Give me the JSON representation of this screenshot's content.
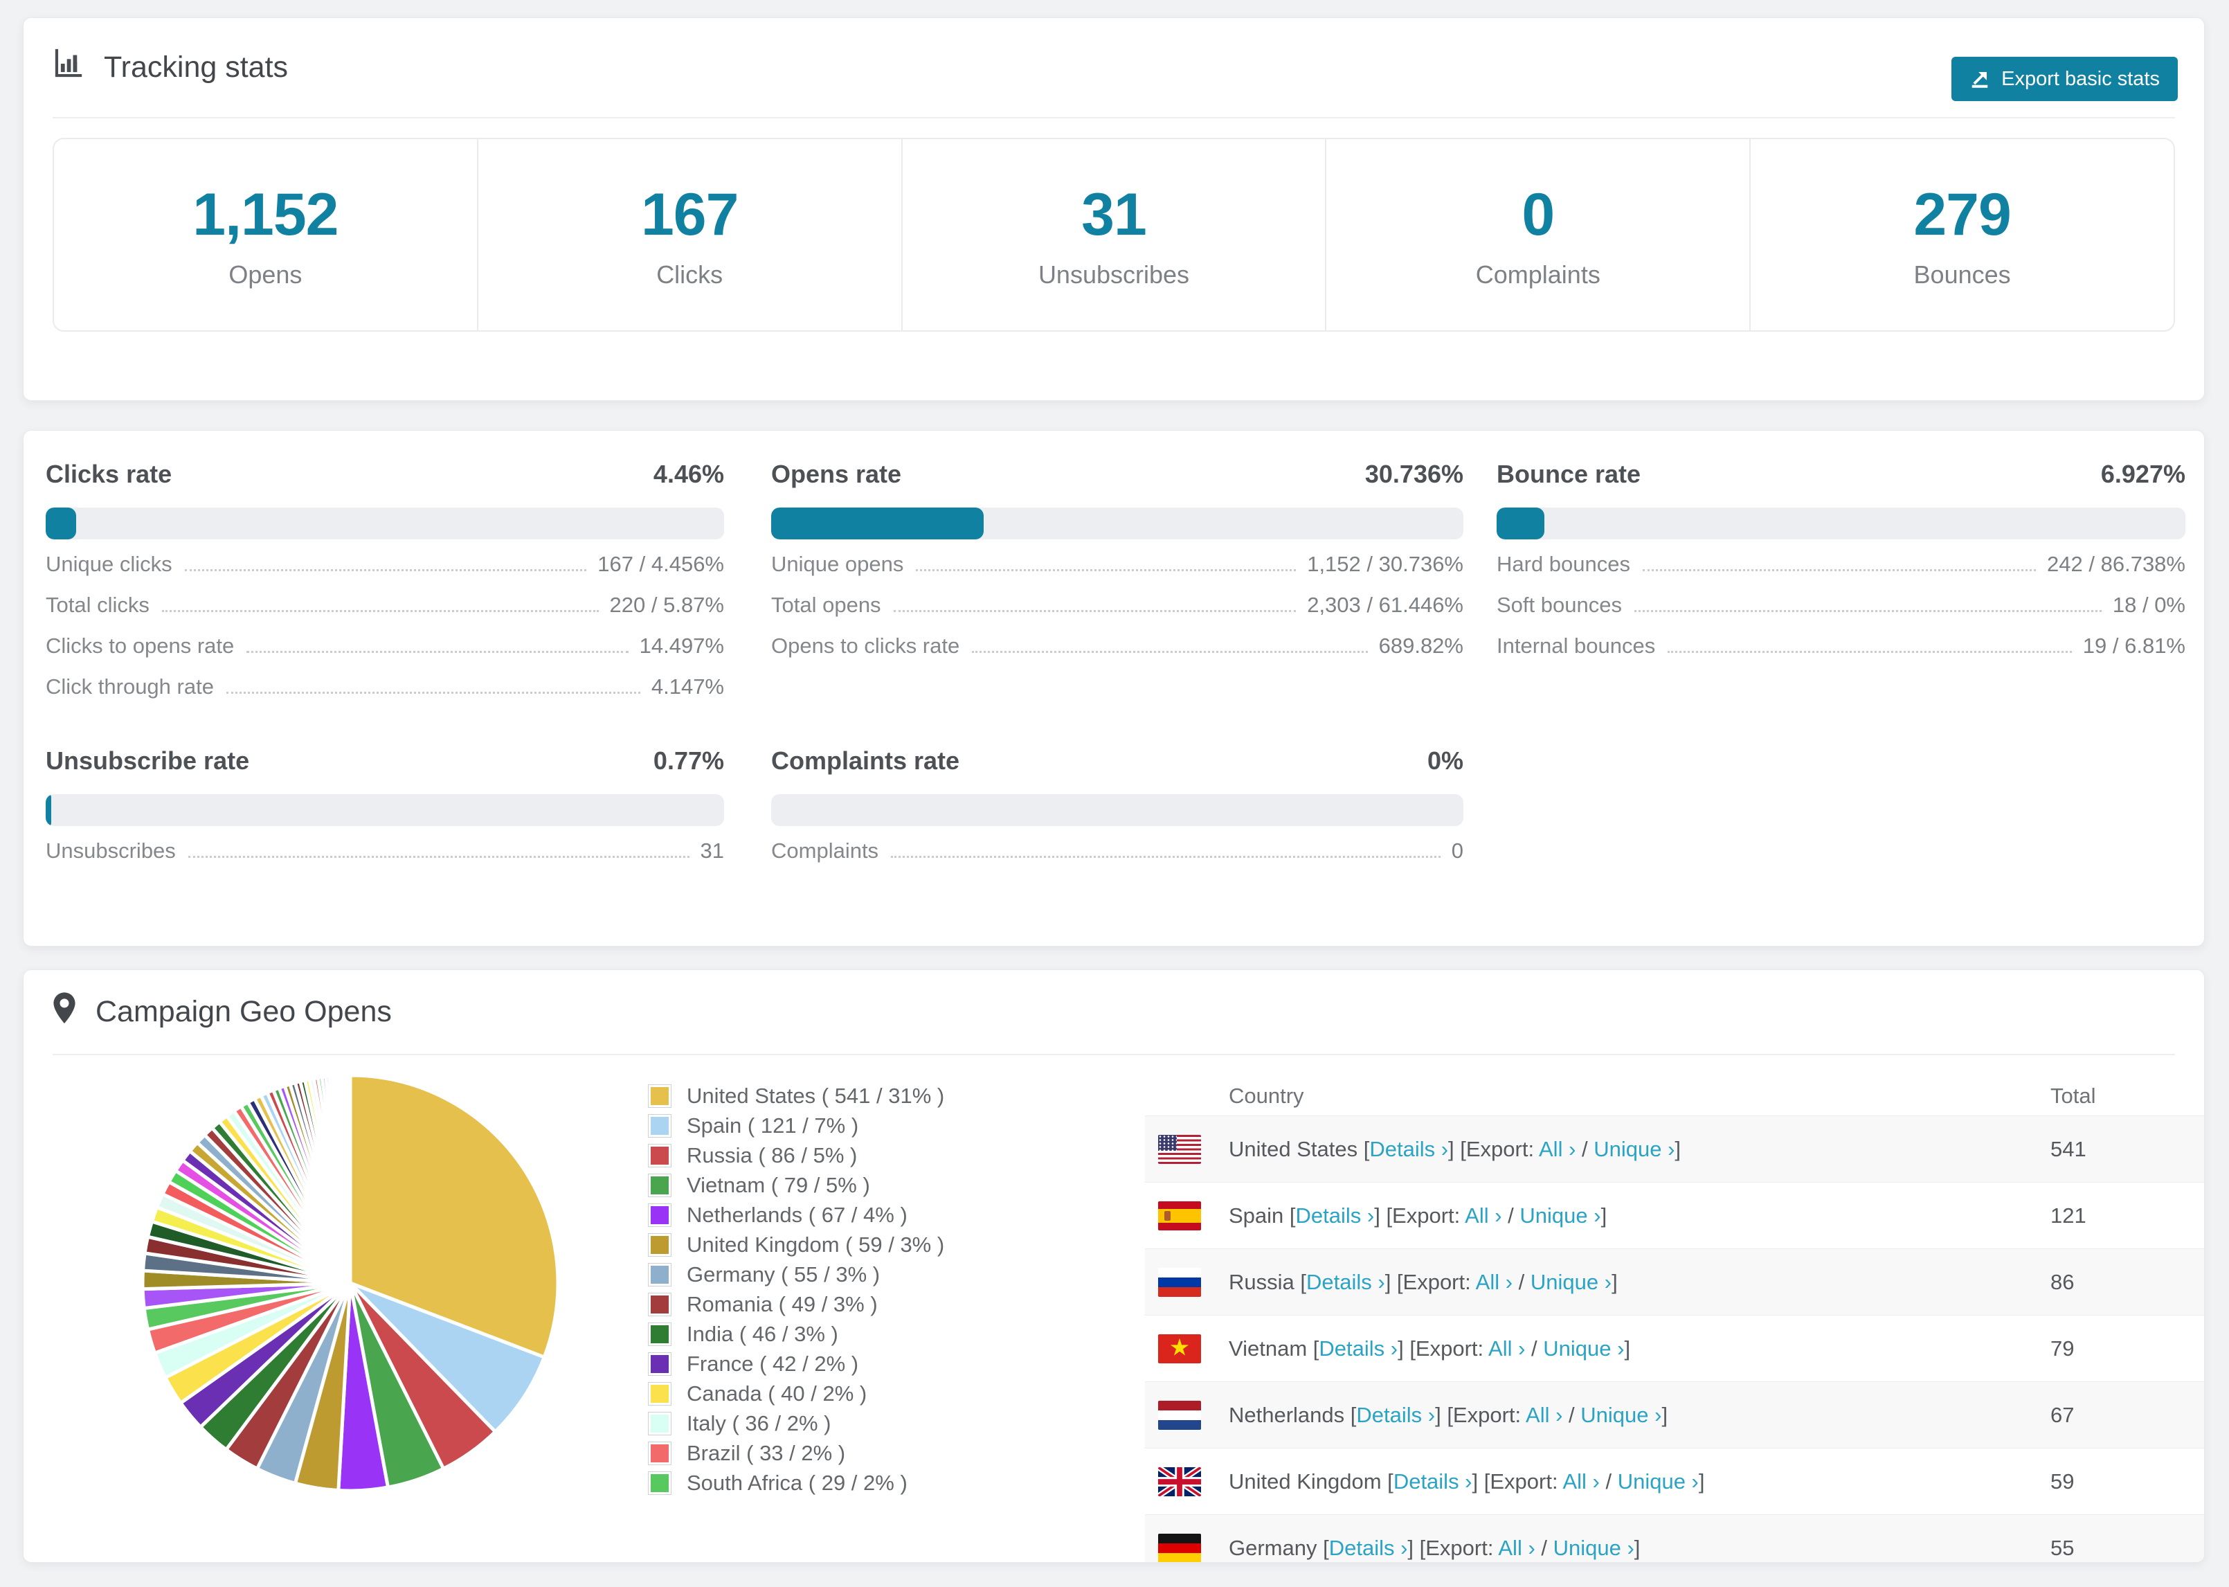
{
  "colors": {
    "accent": "#1181a1",
    "link": "#2aa3c4",
    "bar_track": "#eceef1",
    "page_background": "#f1f2f4"
  },
  "tracking": {
    "title": "Tracking stats",
    "export_button": "Export basic stats",
    "boxes": [
      {
        "value": "1,152",
        "label": "Opens"
      },
      {
        "value": "167",
        "label": "Clicks"
      },
      {
        "value": "31",
        "label": "Unsubscribes"
      },
      {
        "value": "0",
        "label": "Complaints"
      },
      {
        "value": "279",
        "label": "Bounces"
      }
    ]
  },
  "rates": {
    "panels": [
      {
        "title": "Clicks rate",
        "value": "4.46%",
        "bar_pct": 4.46,
        "col": 0,
        "row": 0,
        "rows": [
          {
            "label": "Unique clicks",
            "value": "167 / 4.456%"
          },
          {
            "label": "Total clicks",
            "value": "220 / 5.87%"
          },
          {
            "label": "Clicks to opens rate",
            "value": "14.497%"
          },
          {
            "label": "Click through rate",
            "value": "4.147%"
          }
        ]
      },
      {
        "title": "Opens rate",
        "value": "30.736%",
        "bar_pct": 30.736,
        "col": 1,
        "row": 0,
        "rows": [
          {
            "label": "Unique opens",
            "value": "1,152 / 30.736%"
          },
          {
            "label": "Total opens",
            "value": "2,303 / 61.446%"
          },
          {
            "label": "Opens to clicks rate",
            "value": "689.82%"
          }
        ]
      },
      {
        "title": "Bounce rate",
        "value": "6.927%",
        "bar_pct": 6.927,
        "col": 2,
        "row": 0,
        "rows": [
          {
            "label": "Hard bounces",
            "value": "242 / 86.738%"
          },
          {
            "label": "Soft bounces",
            "value": "18 / 0%"
          },
          {
            "label": "Internal bounces",
            "value": "19 / 6.81%"
          }
        ]
      },
      {
        "title": "Unsubscribe rate",
        "value": "0.77%",
        "bar_pct": 0.77,
        "col": 0,
        "row": 1,
        "rows": [
          {
            "label": "Unsubscribes",
            "value": "31"
          }
        ]
      },
      {
        "title": "Complaints rate",
        "value": "0%",
        "bar_pct": 0,
        "col": 1,
        "row": 1,
        "rows": [
          {
            "label": "Complaints",
            "value": "0"
          }
        ]
      }
    ]
  },
  "geo": {
    "title": "Campaign Geo Opens",
    "table": {
      "columns": [
        "Country",
        "Total"
      ],
      "bracket_open": "[",
      "bracket_close": "]",
      "details_label": "Details ›",
      "export_label": "Export:",
      "all_label": "All ›",
      "slash": "/",
      "unique_label": "Unique ›",
      "rows": [
        {
          "country": "United States",
          "code": "us",
          "total": "541"
        },
        {
          "country": "Spain",
          "code": "es",
          "total": "121"
        },
        {
          "country": "Russia",
          "code": "ru",
          "total": "86"
        },
        {
          "country": "Vietnam",
          "code": "vn",
          "total": "79"
        },
        {
          "country": "Netherlands",
          "code": "nl",
          "total": "67"
        },
        {
          "country": "United Kingdom",
          "code": "gb",
          "total": "59"
        },
        {
          "country": "Germany",
          "code": "de",
          "total": "55"
        }
      ]
    }
  },
  "chart_data": {
    "type": "pie",
    "title": "Campaign Geo Opens",
    "legend_position": "right",
    "labels": [
      "United States",
      "Spain",
      "Russia",
      "Vietnam",
      "Netherlands",
      "United Kingdom",
      "Germany",
      "Romania",
      "India",
      "France",
      "Canada",
      "Italy",
      "Brazil",
      "South Africa"
    ],
    "values": [
      541,
      121,
      86,
      79,
      67,
      59,
      55,
      49,
      46,
      42,
      40,
      36,
      33,
      29
    ],
    "percentages": [
      31,
      7,
      5,
      5,
      4,
      3,
      3,
      3,
      3,
      2,
      2,
      2,
      2,
      2
    ],
    "legend_labels": [
      "United States ( 541 / 31% )",
      "Spain ( 121 / 7% )",
      "Russia ( 86 / 5% )",
      "Vietnam ( 79 / 5% )",
      "Netherlands ( 67 / 4% )",
      "United Kingdom ( 59 / 3% )",
      "Germany ( 55 / 3% )",
      "Romania ( 49 / 3% )",
      "India ( 46 / 3% )",
      "France ( 42 / 2% )",
      "Canada ( 40 / 2% )",
      "Italy ( 36 / 2% )",
      "Brazil ( 33 / 2% )",
      "South Africa ( 29 / 2% )"
    ],
    "colors": [
      "#e5c04d",
      "#abd3f2",
      "#ca4a4e",
      "#4aa64e",
      "#9933f5",
      "#bd9b30",
      "#8fb0cd",
      "#a33d3d",
      "#2e7d32",
      "#6a2fb2",
      "#fbe14b",
      "#d9fef4",
      "#f26a6a",
      "#57c95f"
    ],
    "others_estimated_total": 462
  }
}
